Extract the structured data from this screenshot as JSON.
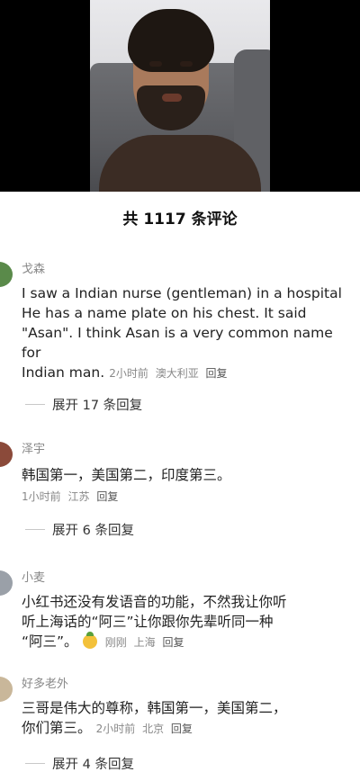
{
  "video": {
    "description_icon": "video-frame"
  },
  "header": {
    "count_title": "共 1117 条评论"
  },
  "comments": [
    {
      "username": "戈森",
      "avatar_color": "#5a8a4a",
      "text_lines": [
        "I saw a Indian nurse (gentleman) in a hospital",
        "He has a name plate on his chest. It said",
        "\"Asan\". I think Asan is a very common name for"
      ],
      "text_last": "Indian man.",
      "time": "2小时前",
      "location": "澳大利亚",
      "reply": "回复",
      "expand": "展开 17 条回复"
    },
    {
      "username": "泽宇",
      "avatar_color": "#8b4a3a",
      "text": "韩国第一，美国第二，印度第三。",
      "time": "1小时前",
      "location": "江苏",
      "reply": "回复",
      "expand": "展开 6 条回复"
    },
    {
      "username": "小麦",
      "avatar_color": "#9aa0a8",
      "text_lines": [
        "小红书还没有发语音的功能，不然我让你听",
        "听上海话的“阿三”让你跟你先辈听同一种"
      ],
      "text_last": "“阿三”。",
      "time": "刚刚",
      "location": "上海",
      "reply": "回复"
    },
    {
      "username": "好多老外",
      "avatar_color": "#c9b79a",
      "text_lines": [
        "三哥是伟大的尊称，韩国第一，美国第二，"
      ],
      "text_last": "你们第三。",
      "time": "2小时前",
      "location": "北京",
      "reply": "回复",
      "expand": "展开 4 条回复"
    }
  ]
}
